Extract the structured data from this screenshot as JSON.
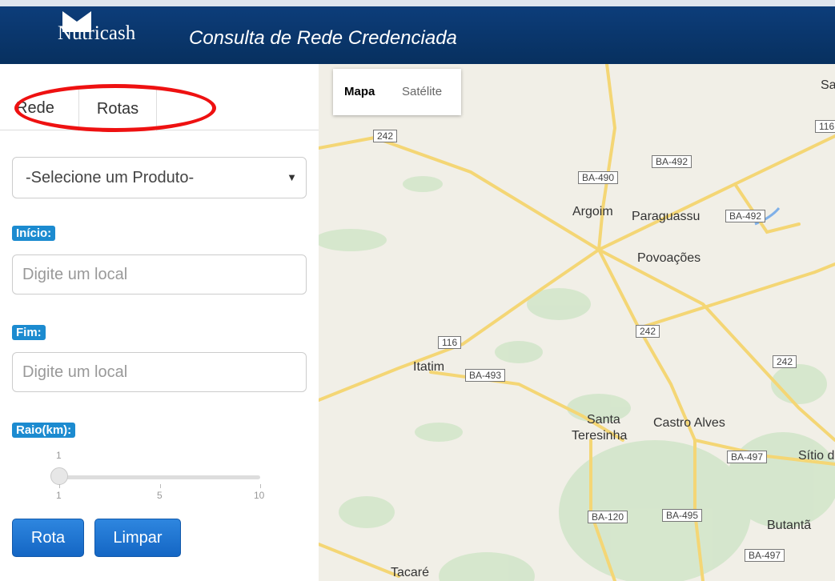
{
  "header": {
    "brand": "Nutricash",
    "title": "Consulta de Rede Credenciada"
  },
  "sidebar": {
    "tabs": [
      {
        "label": "Rede"
      },
      {
        "label": "Rotas"
      }
    ],
    "product_select": {
      "value": "-Selecione um Produto-"
    },
    "start": {
      "label": "Início:",
      "placeholder": "Digite um local"
    },
    "end": {
      "label": "Fim:",
      "placeholder": "Digite um local"
    },
    "radius": {
      "label": "Raio(km):",
      "value": 1,
      "min_label": "1",
      "mid_label": "5",
      "max_label": "10",
      "current_label": "1"
    },
    "buttons": {
      "route": "Rota",
      "clear": "Limpar"
    }
  },
  "map": {
    "type_control": {
      "map": "Mapa",
      "satellite": "Satélite"
    },
    "places": [
      "Argoim",
      "Paraguassu",
      "Povoações",
      "Itatim",
      "Santa",
      "Teresinha",
      "Castro Alves",
      "Sítio d",
      "Butantã",
      "Tacaré",
      "Sa"
    ],
    "shields": [
      "242",
      "BA-490",
      "BA-492",
      "BA-492",
      "116",
      "242",
      "BA-493",
      "242",
      "BA-497",
      "BA-120",
      "BA-495",
      "BA-497",
      "116"
    ]
  },
  "colors": {
    "header": "#0d3d7a",
    "accent": "#1c8bd0",
    "button": "#1466c4",
    "annotation": "#e11111",
    "map_bg": "#f1efe7",
    "road": "#f4d675"
  }
}
